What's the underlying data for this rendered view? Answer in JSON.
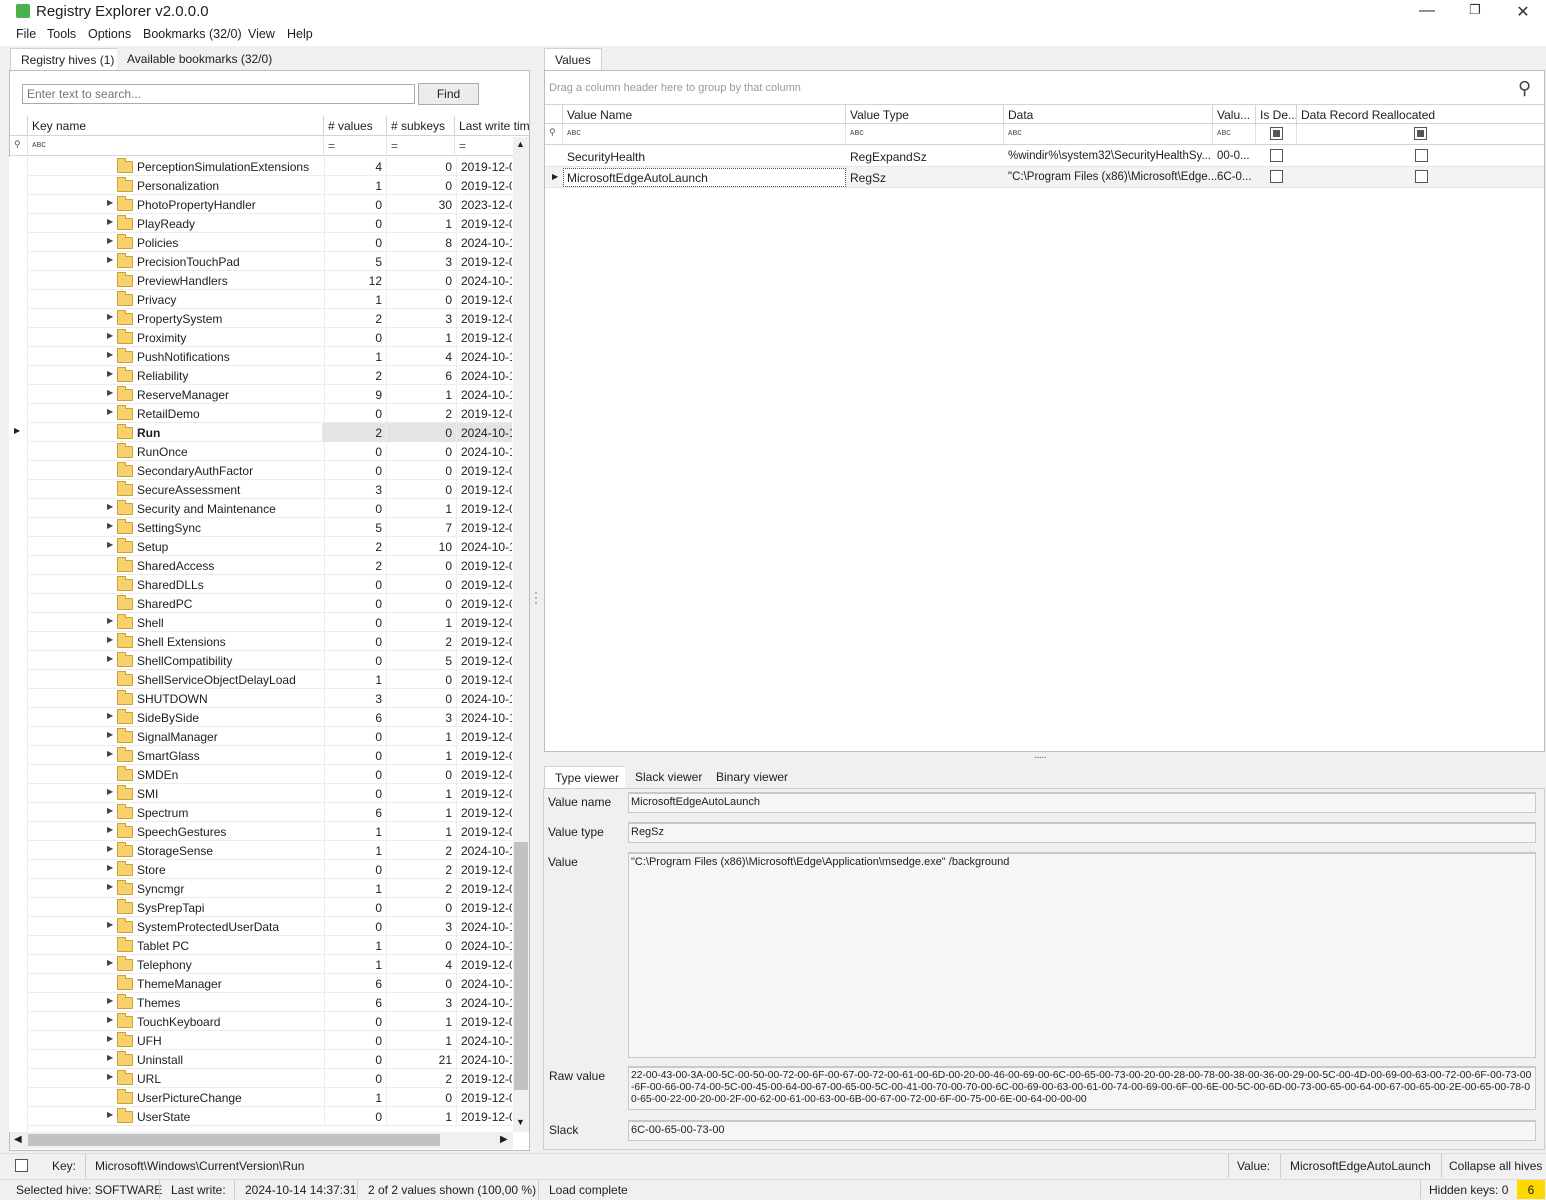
{
  "app": {
    "title": "Registry Explorer v2.0.0.0"
  },
  "menu": [
    "File",
    "Tools",
    "Options",
    "Bookmarks (32/0)",
    "View",
    "Help"
  ],
  "left_tabs": {
    "hives": "Registry hives (1)",
    "bookmarks": "Available bookmarks (32/0)"
  },
  "search": {
    "placeholder": "Enter text to search...",
    "find": "Find"
  },
  "tree_headers": {
    "key": "Key name",
    "values": "# values",
    "subkeys": "# subkeys",
    "lastwrite": "Last write time"
  },
  "tree_rows": [
    {
      "name": "PerceptionSimulationExtensions",
      "values": "4",
      "subkeys": "0",
      "last": "2019-12-0",
      "exp": false
    },
    {
      "name": "Personalization",
      "values": "1",
      "subkeys": "0",
      "last": "2019-12-0",
      "exp": false
    },
    {
      "name": "PhotoPropertyHandler",
      "values": "0",
      "subkeys": "30",
      "last": "2023-12-0",
      "exp": true
    },
    {
      "name": "PlayReady",
      "values": "0",
      "subkeys": "1",
      "last": "2019-12-0",
      "exp": true
    },
    {
      "name": "Policies",
      "values": "0",
      "subkeys": "8",
      "last": "2024-10-1",
      "exp": true
    },
    {
      "name": "PrecisionTouchPad",
      "values": "5",
      "subkeys": "3",
      "last": "2019-12-0",
      "exp": true
    },
    {
      "name": "PreviewHandlers",
      "values": "12",
      "subkeys": "0",
      "last": "2024-10-1",
      "exp": false
    },
    {
      "name": "Privacy",
      "values": "1",
      "subkeys": "0",
      "last": "2019-12-0",
      "exp": false
    },
    {
      "name": "PropertySystem",
      "values": "2",
      "subkeys": "3",
      "last": "2019-12-0",
      "exp": true
    },
    {
      "name": "Proximity",
      "values": "0",
      "subkeys": "1",
      "last": "2019-12-0",
      "exp": true
    },
    {
      "name": "PushNotifications",
      "values": "1",
      "subkeys": "4",
      "last": "2024-10-1",
      "exp": true
    },
    {
      "name": "Reliability",
      "values": "2",
      "subkeys": "6",
      "last": "2024-10-1",
      "exp": true
    },
    {
      "name": "ReserveManager",
      "values": "9",
      "subkeys": "1",
      "last": "2024-10-1",
      "exp": true
    },
    {
      "name": "RetailDemo",
      "values": "0",
      "subkeys": "2",
      "last": "2019-12-0",
      "exp": true
    },
    {
      "name": "Run",
      "values": "2",
      "subkeys": "0",
      "last": "2024-10-1",
      "exp": false,
      "selected": true
    },
    {
      "name": "RunOnce",
      "values": "0",
      "subkeys": "0",
      "last": "2024-10-1",
      "exp": false
    },
    {
      "name": "SecondaryAuthFactor",
      "values": "0",
      "subkeys": "0",
      "last": "2019-12-0",
      "exp": false
    },
    {
      "name": "SecureAssessment",
      "values": "3",
      "subkeys": "0",
      "last": "2019-12-0",
      "exp": false
    },
    {
      "name": "Security and Maintenance",
      "values": "0",
      "subkeys": "1",
      "last": "2019-12-0",
      "exp": true
    },
    {
      "name": "SettingSync",
      "values": "5",
      "subkeys": "7",
      "last": "2019-12-0",
      "exp": true
    },
    {
      "name": "Setup",
      "values": "2",
      "subkeys": "10",
      "last": "2024-10-1",
      "exp": true
    },
    {
      "name": "SharedAccess",
      "values": "2",
      "subkeys": "0",
      "last": "2019-12-0",
      "exp": false
    },
    {
      "name": "SharedDLLs",
      "values": "0",
      "subkeys": "0",
      "last": "2019-12-0",
      "exp": false
    },
    {
      "name": "SharedPC",
      "values": "0",
      "subkeys": "0",
      "last": "2019-12-0",
      "exp": false
    },
    {
      "name": "Shell",
      "values": "0",
      "subkeys": "1",
      "last": "2019-12-0",
      "exp": true
    },
    {
      "name": "Shell Extensions",
      "values": "0",
      "subkeys": "2",
      "last": "2019-12-0",
      "exp": true
    },
    {
      "name": "ShellCompatibility",
      "values": "0",
      "subkeys": "5",
      "last": "2019-12-0",
      "exp": true
    },
    {
      "name": "ShellServiceObjectDelayLoad",
      "values": "1",
      "subkeys": "0",
      "last": "2019-12-0",
      "exp": false
    },
    {
      "name": "SHUTDOWN",
      "values": "3",
      "subkeys": "0",
      "last": "2024-10-1",
      "exp": false
    },
    {
      "name": "SideBySide",
      "values": "6",
      "subkeys": "3",
      "last": "2024-10-1",
      "exp": true
    },
    {
      "name": "SignalManager",
      "values": "0",
      "subkeys": "1",
      "last": "2019-12-0",
      "exp": true
    },
    {
      "name": "SmartGlass",
      "values": "0",
      "subkeys": "1",
      "last": "2019-12-0",
      "exp": true
    },
    {
      "name": "SMDEn",
      "values": "0",
      "subkeys": "0",
      "last": "2019-12-0",
      "exp": false
    },
    {
      "name": "SMI",
      "values": "0",
      "subkeys": "1",
      "last": "2019-12-0",
      "exp": true
    },
    {
      "name": "Spectrum",
      "values": "6",
      "subkeys": "1",
      "last": "2019-12-0",
      "exp": true
    },
    {
      "name": "SpeechGestures",
      "values": "1",
      "subkeys": "1",
      "last": "2019-12-0",
      "exp": true
    },
    {
      "name": "StorageSense",
      "values": "1",
      "subkeys": "2",
      "last": "2024-10-1",
      "exp": true
    },
    {
      "name": "Store",
      "values": "0",
      "subkeys": "2",
      "last": "2019-12-0",
      "exp": true
    },
    {
      "name": "Syncmgr",
      "values": "1",
      "subkeys": "2",
      "last": "2019-12-0",
      "exp": true
    },
    {
      "name": "SysPrepTapi",
      "values": "0",
      "subkeys": "0",
      "last": "2019-12-0",
      "exp": false
    },
    {
      "name": "SystemProtectedUserData",
      "values": "0",
      "subkeys": "3",
      "last": "2024-10-1",
      "exp": true
    },
    {
      "name": "Tablet PC",
      "values": "1",
      "subkeys": "0",
      "last": "2024-10-1",
      "exp": false
    },
    {
      "name": "Telephony",
      "values": "1",
      "subkeys": "4",
      "last": "2019-12-0",
      "exp": true
    },
    {
      "name": "ThemeManager",
      "values": "6",
      "subkeys": "0",
      "last": "2024-10-1",
      "exp": false
    },
    {
      "name": "Themes",
      "values": "6",
      "subkeys": "3",
      "last": "2024-10-1",
      "exp": true
    },
    {
      "name": "TouchKeyboard",
      "values": "0",
      "subkeys": "1",
      "last": "2019-12-0",
      "exp": true
    },
    {
      "name": "UFH",
      "values": "0",
      "subkeys": "1",
      "last": "2024-10-1",
      "exp": true
    },
    {
      "name": "Uninstall",
      "values": "0",
      "subkeys": "21",
      "last": "2024-10-1",
      "exp": true
    },
    {
      "name": "URL",
      "values": "0",
      "subkeys": "2",
      "last": "2019-12-0",
      "exp": true
    },
    {
      "name": "UserPictureChange",
      "values": "1",
      "subkeys": "0",
      "last": "2019-12-0",
      "exp": false
    },
    {
      "name": "UserState",
      "values": "0",
      "subkeys": "1",
      "last": "2019-12-0",
      "exp": true
    }
  ],
  "values_tab": "Values",
  "group_hint": "Drag a column header here to group by that column",
  "value_headers": {
    "name": "Value Name",
    "type": "Value Type",
    "data": "Data",
    "valu": "Valu...",
    "isdel": "Is De...",
    "realloc": "Data Record Reallocated"
  },
  "value_rows": [
    {
      "name": "SecurityHealth",
      "type": "RegExpandSz",
      "data": "%windir%\\system32\\SecurityHealthSy...",
      "valu": "00-0..."
    },
    {
      "name": "MicrosoftEdgeAutoLaunch",
      "type": "RegSz",
      "data": "\"C:\\Program Files (x86)\\Microsoft\\Edge...",
      "valu": "6C-0..."
    }
  ],
  "viewer_tabs": {
    "type": "Type viewer",
    "slack": "Slack viewer",
    "binary": "Binary viewer"
  },
  "viewer": {
    "name_label": "Value name",
    "name": "MicrosoftEdgeAutoLaunch",
    "type_label": "Value type",
    "type": "RegSz",
    "value_label": "Value",
    "value": "\"C:\\Program Files (x86)\\Microsoft\\Edge\\Application\\msedge.exe\" /background",
    "raw_label": "Raw value",
    "raw": "22-00-43-00-3A-00-5C-00-50-00-72-00-6F-00-67-00-72-00-61-00-6D-00-20-00-46-00-69-00-6C-00-65-00-73-00-20-00-28-00-78-00-38-00-36-00-29-00-5C-00-4D-00-69-00-63-00-72-00-6F-00-73-00-6F-00-66-00-74-00-5C-00-45-00-64-00-67-00-65-00-5C-00-41-00-70-00-70-00-6C-00-69-00-63-00-61-00-74-00-69-00-6F-00-6E-00-5C-00-6D-00-73-00-65-00-64-00-67-00-65-00-2E-00-65-00-78-00-65-00-22-00-20-00-2F-00-62-00-61-00-63-00-6B-00-67-00-72-00-6F-00-75-00-6E-00-64-00-00-00",
    "slack_label": "Slack",
    "slack": "6C-00-65-00-73-00"
  },
  "keybar": {
    "key_label": "Key:",
    "key": "Microsoft\\Windows\\CurrentVersion\\Run",
    "value_label": "Value:",
    "value": "MicrosoftEdgeAutoLaunch",
    "collapse": "Collapse all hives"
  },
  "status": {
    "hive": "Selected hive: SOFTWARE",
    "lastwrite_label": "Last write:",
    "lastwrite": "2024-10-14 14:37:31",
    "shown": "2 of 2 values shown (100,00 %)",
    "load": "Load complete",
    "hidden": "Hidden keys: 0",
    "count": "6"
  }
}
